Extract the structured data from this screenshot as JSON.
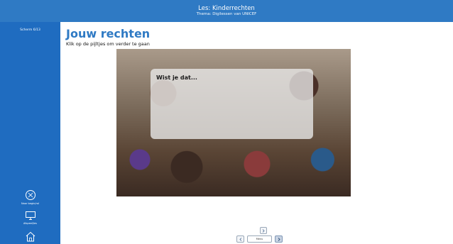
{
  "header": {
    "lesson": "Les: Kinderrechten",
    "theme": "Thema: Digilessen van UNICEF"
  },
  "sidebar": {
    "screen_counter": "Scherm 6/13",
    "buttons": [
      {
        "icon": "unicef-logo-icon",
        "label": "Naar begin/rol"
      },
      {
        "icon": "monitor-icon",
        "label": "Afspeel/les"
      },
      {
        "icon": "home-icon",
        "label": ""
      }
    ]
  },
  "main": {
    "title": "Jouw rechten",
    "instruction": "Klik op de pijltjes om verder te gaan",
    "overlay_text": "Wist je dat..."
  },
  "nav": {
    "menu_label": "Menu"
  },
  "colors": {
    "brand_blue": "#2f7ac4",
    "sidebar_blue": "#1f6cc0"
  }
}
